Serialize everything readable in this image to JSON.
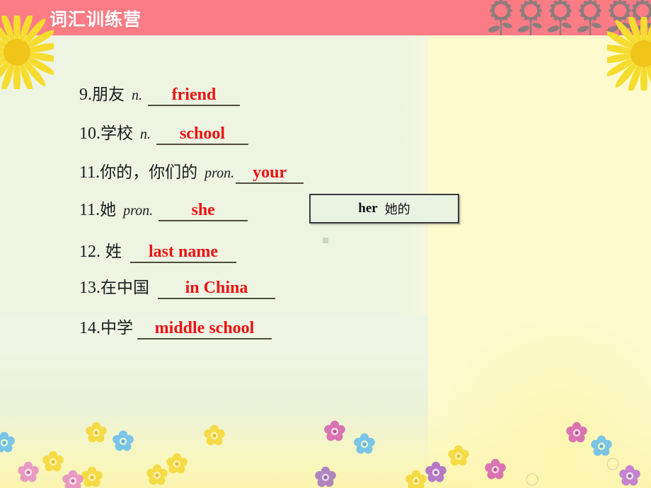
{
  "slide": {
    "title": "词汇训练营",
    "colors": {
      "banner": "#FB7C85",
      "panel_green": "#EDF4E2",
      "background_yellow": "#FDFACE",
      "answer_red": "#EE1111",
      "underline": "#4E4E3B"
    }
  },
  "banner": {
    "title": "词汇训练营",
    "decor_flower_count": 6
  },
  "word_list": [
    {
      "number": "9.",
      "chinese": "朋友",
      "pos": "n.",
      "answer": "friend"
    },
    {
      "number": "10.",
      "chinese": "学校",
      "pos": "n.",
      "answer": "school"
    },
    {
      "number": "11.",
      "chinese": "你的，你们的",
      "pos": "pron.",
      "answer": "your"
    },
    {
      "number": "11.",
      "chinese": "她",
      "pos": "pron.",
      "answer": "she"
    },
    {
      "number": "12.",
      "chinese": "姓",
      "pos": "",
      "answer": "last name"
    },
    {
      "number": "13.",
      "chinese": "在中国",
      "pos": "",
      "answer": "in China"
    },
    {
      "number": "14.",
      "chinese": "中学",
      "pos": "",
      "answer": "middle school"
    }
  ],
  "callout": {
    "english": "her",
    "chinese": "她的"
  }
}
